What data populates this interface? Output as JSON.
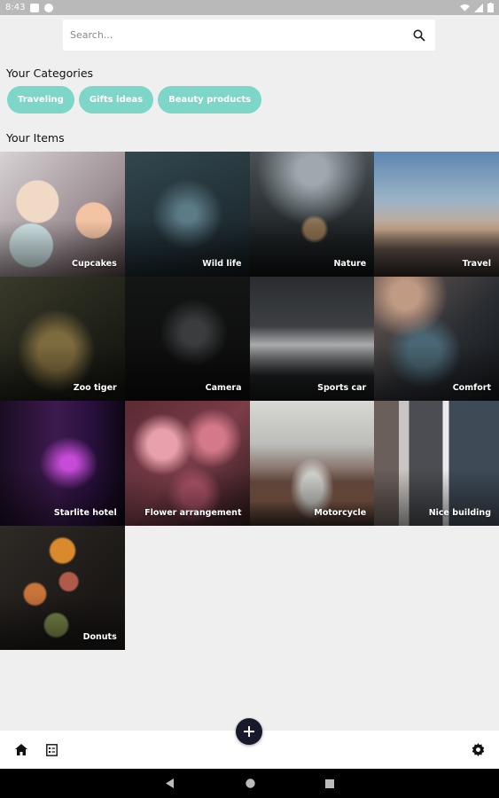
{
  "status_bar": {
    "time": "8:43",
    "icons": [
      "message-icon",
      "app-icon",
      "wifi-icon",
      "signal-icon",
      "battery-icon"
    ]
  },
  "search": {
    "placeholder": "Search...",
    "icon": "search-icon"
  },
  "categories": {
    "title": "Your Categories",
    "items": [
      "Traveling",
      "Gifts ideas",
      "Beauty products"
    ],
    "chip_color": "#7dd6c8"
  },
  "items": {
    "title": "Your Items",
    "list": [
      {
        "label": "Cupcakes"
      },
      {
        "label": "Wild life"
      },
      {
        "label": "Nature"
      },
      {
        "label": "Travel"
      },
      {
        "label": "Zoo tiger"
      },
      {
        "label": "Camera"
      },
      {
        "label": "Sports car"
      },
      {
        "label": "Comfort"
      },
      {
        "label": "Starlite hotel"
      },
      {
        "label": "Flower arrangement"
      },
      {
        "label": "Motorcycle"
      },
      {
        "label": "Nice building"
      },
      {
        "label": "Donuts"
      }
    ]
  },
  "bottom_bar": {
    "left_icons": [
      "home-icon",
      "notes-icon"
    ],
    "right_icon": "settings-icon",
    "fab_icon": "plus-icon",
    "fab_color": "#181a2c"
  },
  "nav_bar": {
    "icons": [
      "back-icon",
      "home-circle-icon",
      "recents-icon"
    ]
  }
}
